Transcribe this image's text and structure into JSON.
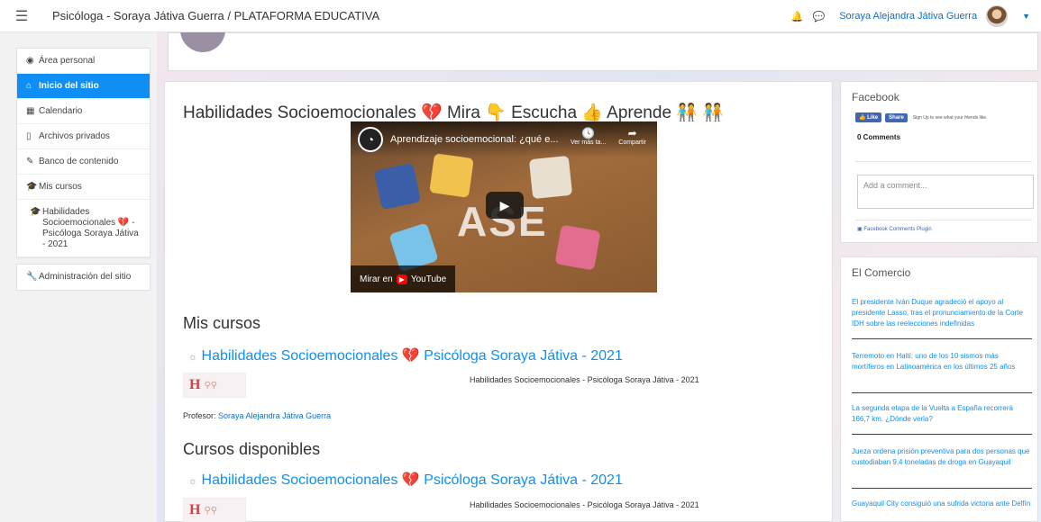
{
  "navbar": {
    "site_title": "Psicóloga - Soraya Játiva Guerra / PLATAFORMA EDUCATIVA",
    "user_name": "Soraya Alejandra Játiva Guerra",
    "icons": [
      "menu-icon",
      "bell-icon",
      "chat-icon",
      "avatar",
      "caret-down-icon"
    ]
  },
  "drawer": {
    "items": [
      {
        "label": "Área personal",
        "icon": "dashboard-icon"
      },
      {
        "label": "Inicio del sitio",
        "icon": "home-icon",
        "active": true
      },
      {
        "label": "Calendario",
        "icon": "calendar-icon"
      },
      {
        "label": "Archivos privados",
        "icon": "file-icon"
      },
      {
        "label": "Banco de contenido",
        "icon": "brush-icon"
      },
      {
        "label": "Mis cursos",
        "icon": "graduation-cap-icon"
      },
      {
        "label": "Habilidades Socioemocionales 💔 - Psicóloga Soraya Játiva - 2021",
        "icon": "graduation-cap-icon"
      }
    ],
    "admin": {
      "label": "Administración del sitio",
      "icon": "wrench-icon"
    }
  },
  "main": {
    "title": "Habilidades Socioemocionales 💔 Mira 👇 Escucha 👍 Aprende 🧑‍🤝‍🧑 🧑‍🤝‍🧑",
    "video": {
      "title": "Aprendizaje socioemocional: ¿qué e...",
      "watch_later": "Ver más ta...",
      "share": "Compartir",
      "big_text": "ASE",
      "watch_on": "Mirar en",
      "youtube": "YouTube"
    },
    "my_courses_heading": "Mis cursos",
    "available_courses_heading": "Cursos disponibles",
    "course": {
      "name": "Habilidades Socioemocionales 💔 Psicóloga Soraya Játiva - 2021",
      "summary": "Habilidades Socioemocionales - Psicóloga Soraya Játiva - 2021",
      "teacher_label": "Profesor:",
      "teacher_name": "Soraya Alejandra Játiva Guerra",
      "image_letter": "H"
    }
  },
  "facebook": {
    "title": "Facebook",
    "like": "Like",
    "share": "Share",
    "signup_note": "Sign Up to see what your friends like.",
    "comments": "0 Comments",
    "comment_placeholder": "Add a comment...",
    "plugin": "Facebook Comments Plugin"
  },
  "news": {
    "title": "El Comercio",
    "items": [
      "El presidente Iván Duque agradeció el apoyo al presidente Lasso, tras el pronunciamiento de la Corte IDH sobre las reelecciones indefinidas",
      "Terremoto en Haití: uno de los 10 sismos más mortíferos en Latinoamérica en los últimos 25 años",
      "La segunda etapa de la Vuelta a España recorrerá 166,7 km. ¿Dónde verla?",
      "Jueza ordena prisión preventiva para dos personas que custodiaban 9,4 toneladas de droga en Guayaquil",
      "Guayaquil City consiguió una sufrida victoria ante Delfín"
    ]
  },
  "colors": {
    "accent": "#0f8ff5",
    "link": "#0f6fc5",
    "facebook": "#4267b2"
  }
}
